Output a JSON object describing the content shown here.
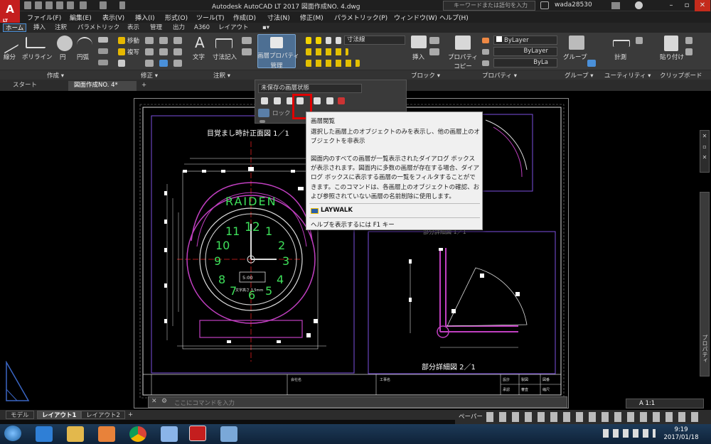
{
  "app": {
    "title": "Autodesk AutoCAD LT 2017    図面作成NO. 4.dwg",
    "logo_letter": "A",
    "logo_sub": "LT",
    "search_placeholder": "キーワードまたは語句を入力",
    "user": "wada28530"
  },
  "menu": [
    "ファイル(F)",
    "編集(E)",
    "表示(V)",
    "挿入(I)",
    "形式(O)",
    "ツール(T)",
    "作成(D)",
    "寸法(N)",
    "修正(M)",
    "パラメトリック(P)",
    "ウィンドウ(W)",
    "ヘルプ(H)"
  ],
  "ribbon_tabs": [
    "ホーム",
    "挿入",
    "注釈",
    "パラメトリック",
    "表示",
    "管理",
    "出力",
    "A360",
    "レイアウト"
  ],
  "ribbon": {
    "draw_buttons": [
      "線分",
      "ポリライン",
      "円",
      "円弧"
    ],
    "modify_small": [
      "移動",
      "複写"
    ],
    "annotate_buttons": [
      "文字",
      "寸法記入"
    ],
    "layer_props_line1": "画層プロパティ",
    "layer_props_line2": "管理",
    "dim_combo": "寸法線",
    "insert_label": "挿入",
    "props_copy_line1": "プロパティ",
    "props_copy_line2": "コピー",
    "bylayer1": "ByLayer",
    "bylayer2": "ByLayer",
    "bylayer3": "ByLa",
    "group_label": "グループ",
    "measure_label": "計測",
    "paste_label": "貼り付け"
  },
  "panels": [
    "作成 ▾",
    "修正 ▾",
    "注釈 ▾",
    "ブロック ▾",
    "プロパティ ▾",
    "グループ ▾",
    "ユーティリティ ▾",
    "クリップボード"
  ],
  "file_tabs": [
    "スタート",
    "図面作成NO. 4*"
  ],
  "layer_panel": {
    "combo": "未保存の画層状態",
    "lock_label": "ロック"
  },
  "tooltip": {
    "title": "画層閲覧",
    "body1": "選択した画層上のオブジェクトのみを表示し、他の画層上のオブジェクトを非表示",
    "body2": "図面内のすべての画層が一覧表示されたダイアログ ボックスが表示されます。図面内に多数の画層が存在する場合、ダイアログ ボックスに表示する画層の一覧をフィルタすることができます。このコマンドは、各画層上のオブジェクトの確認、および参照されていない画層の名前削除に使用します。",
    "command": "LAYWALK",
    "help": "ヘルプを表示するには F1 キー"
  },
  "drawing": {
    "front_title": "目覚まし時計正面図 1／1",
    "detail_title_top": "部分詳細図 1／1",
    "detail_title": "部分詳細図 2／1",
    "brand": "RAIDEN",
    "numbers": [
      "12",
      "1",
      "2",
      "3",
      "4",
      "5",
      "6",
      "7",
      "8",
      "9",
      "10",
      "11"
    ],
    "box_label": "5:00",
    "small_label": "文字高さ 3.5mm",
    "tb1": "会社名",
    "tb2": "工事名",
    "tb3": "承認",
    "tb4": "審査",
    "tb5": "設計",
    "tb6": "製図",
    "tb7": "縮尺",
    "tb8": "図番"
  },
  "command_line": {
    "placeholder": "ここにコマンドを入力"
  },
  "layout_tabs": [
    "モデル",
    "レイアウト1",
    "レイアウト2"
  ],
  "status": {
    "paper": "ペーパー",
    "annotation": "A 1:1"
  },
  "side_strip_label": "プロパティ",
  "clock": {
    "time": "9:19",
    "date": "2017/01/18"
  }
}
